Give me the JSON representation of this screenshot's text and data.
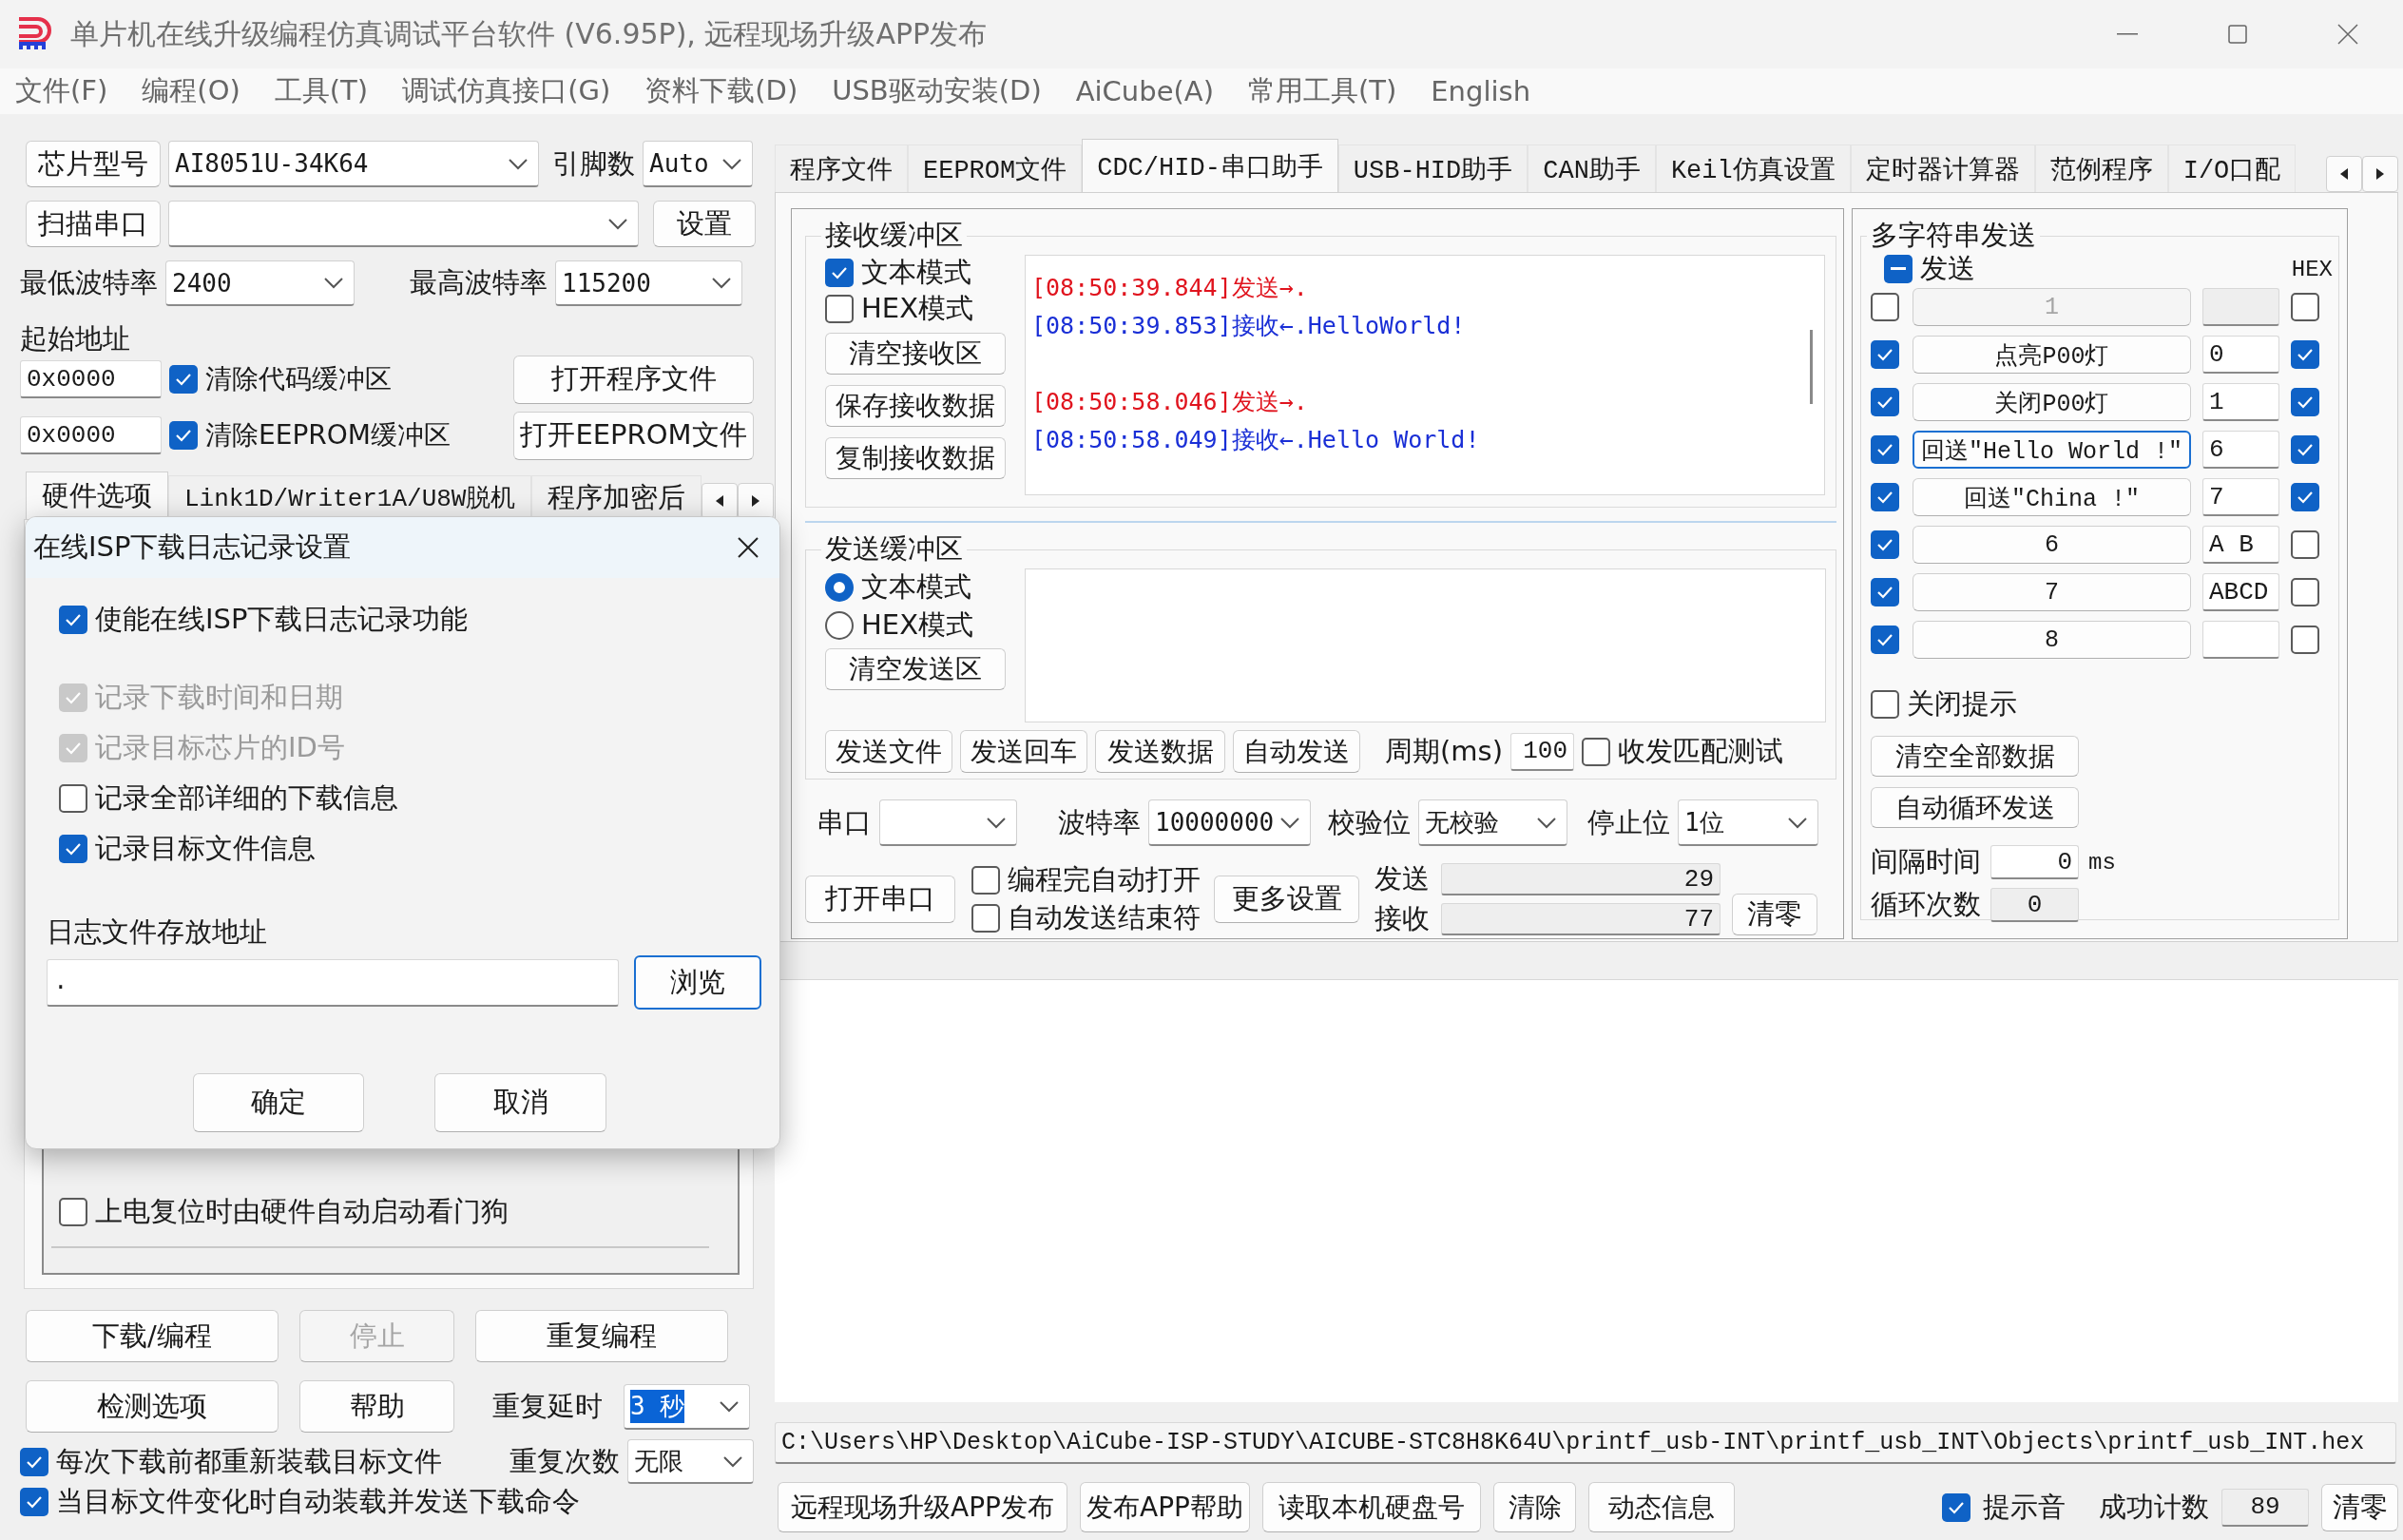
{
  "window": {
    "title": "单片机在线升级编程仿真调试平台软件 (V6.95P), 远程现场升级APP发布"
  },
  "menu": [
    "文件(F)",
    "编程(O)",
    "工具(T)",
    "调试仿真接口(G)",
    "资料下载(D)",
    "USB驱动安装(D)",
    "AiCube(A)",
    "常用工具(T)",
    "English"
  ],
  "left": {
    "chip_button": "芯片型号",
    "chip_model": "AI8051U-34K64",
    "pins_label": "引脚数",
    "pins": "Auto",
    "scan_button": "扫描串口",
    "settings_button": "设置",
    "min_baud_label": "最低波特率",
    "min_baud": "2400",
    "max_baud_label": "最高波特率",
    "max_baud": "115200",
    "start_address_label": "起始地址",
    "address_rows": [
      {
        "address": "0x0000",
        "label": "清除代码缓冲区",
        "checked": true,
        "button": "打开程序文件"
      },
      {
        "address": "0x0000",
        "label": "清除EEPROM缓冲区",
        "checked": true,
        "button": "打开EEPROM文件"
      }
    ],
    "tabs": [
      {
        "label": "硬件选项",
        "selected": true
      },
      {
        "label": "Link1D/Writer1A/U8W脱机",
        "selected": false
      },
      {
        "label": "程序加密后",
        "selected": false
      }
    ],
    "hardware_options": [
      {
        "label": "上电复位时由硬件自动启动看门狗",
        "checked": false
      }
    ],
    "buttons": [
      {
        "label": "下载/编程",
        "disabled": false
      },
      {
        "label": "停止",
        "disabled": true
      },
      {
        "label": "重复编程",
        "disabled": false
      },
      {
        "label": "检测选项",
        "disabled": false
      },
      {
        "label": "帮助",
        "disabled": false
      }
    ],
    "repeat_delay": {
      "label": "重复延时",
      "value": "3 秒",
      "highlighted": true
    },
    "repeat_count": {
      "label": "重复次数",
      "value": "无限",
      "highlighted": false
    },
    "options": [
      {
        "label": "每次下载前都重新装载目标文件",
        "checked": true
      },
      {
        "label": "当目标文件变化时自动装载并发送下载命令",
        "checked": true
      }
    ]
  },
  "dialog": {
    "title": "在线ISP下载日志记录设置",
    "enable": {
      "label": "使能在线ISP下载日志记录功能",
      "checked": true
    },
    "options": [
      {
        "label": "记录下载时间和日期",
        "checked": true,
        "disabled": true
      },
      {
        "label": "记录目标芯片的ID号",
        "checked": true,
        "disabled": true
      },
      {
        "label": "记录全部详细的下载信息",
        "checked": false,
        "disabled": false
      },
      {
        "label": "记录目标文件信息",
        "checked": true,
        "disabled": false
      }
    ],
    "path_label": "日志文件存放地址",
    "path": ".",
    "browse_button": "浏览",
    "ok_button": "确定",
    "cancel_button": "取消"
  },
  "tabs": [
    {
      "label": "程序文件",
      "selected": false
    },
    {
      "label": "EEPROM文件",
      "selected": false
    },
    {
      "label": "CDC/HID-串口助手",
      "selected": true
    },
    {
      "label": "USB-HID助手",
      "selected": false
    },
    {
      "label": "CAN助手",
      "selected": false
    },
    {
      "label": "Keil仿真设置",
      "selected": false
    },
    {
      "label": "定时器计算器",
      "selected": false
    },
    {
      "label": "范例程序",
      "selected": false
    },
    {
      "label": "I/O口配",
      "selected": false
    }
  ],
  "receive": {
    "title": "接收缓冲区",
    "modes": [
      {
        "label": "文本模式",
        "checked": true
      },
      {
        "label": "HEX模式",
        "checked": false
      }
    ],
    "buttons": [
      "清空接收区",
      "保存接收数据",
      "复制接收数据"
    ],
    "log": [
      {
        "lines": [
          {
            "kind": "sent",
            "text": "[08:50:39.844]发送→."
          },
          {
            "kind": "received",
            "text": "[08:50:39.853]接收←.HelloWorld!"
          }
        ]
      },
      {
        "lines": [
          {
            "kind": "sent",
            "text": "[08:50:58.046]发送→."
          },
          {
            "kind": "received",
            "text": "[08:50:58.049]接收←.Hello World!"
          }
        ]
      }
    ]
  },
  "send": {
    "title": "发送缓冲区",
    "modes": [
      {
        "label": "文本模式",
        "selected": true
      },
      {
        "label": "HEX模式",
        "selected": false
      }
    ],
    "clear_button": "清空发送区",
    "buttons": [
      "发送文件",
      "发送回车",
      "发送数据",
      "自动发送"
    ],
    "period_label": "周期(ms)",
    "period": "100",
    "match_test": {
      "label": "收发匹配测试",
      "checked": false
    }
  },
  "serial": {
    "port_label": "串口",
    "baud_label": "波特率",
    "baud": "10000000",
    "parity_label": "校验位",
    "parity": "无校验",
    "stop_label": "停止位",
    "stop": "1位",
    "open_button": "打开串口",
    "auto_options": [
      {
        "label": "编程完自动打开",
        "checked": false
      },
      {
        "label": "自动发送结束符",
        "checked": false
      }
    ],
    "more_button": "更多设置",
    "counters": [
      {
        "label": "发送",
        "value": "29"
      },
      {
        "label": "接收",
        "value": "77"
      }
    ],
    "clear_button": "清零"
  },
  "multi_send": {
    "title": "多字符串发送",
    "send_all": {
      "label": "发送",
      "indeterminate": true
    },
    "hex_label": "HEX",
    "rows": [
      {
        "enabled": false,
        "label": "1",
        "hex": false,
        "disabled": true,
        "focused": false
      },
      {
        "enabled": true,
        "label": "点亮P00灯",
        "data": "0",
        "hex": true,
        "disabled": false,
        "focused": false
      },
      {
        "enabled": true,
        "label": "关闭P00灯",
        "data": "1",
        "hex": true,
        "disabled": false,
        "focused": false
      },
      {
        "enabled": true,
        "label": "回送\"Hello World !\"",
        "data": "6",
        "hex": true,
        "disabled": false,
        "focused": true
      },
      {
        "enabled": true,
        "label": "回送\"China !\"",
        "data": "7",
        "hex": true,
        "disabled": false,
        "focused": false
      },
      {
        "enabled": true,
        "label": "6",
        "data": "A B",
        "hex": false,
        "disabled": false,
        "focused": false
      },
      {
        "enabled": true,
        "label": "7",
        "data": "ABCD",
        "hex": false,
        "disabled": false,
        "focused": false
      },
      {
        "enabled": true,
        "label": "8",
        "hex": false,
        "disabled": false,
        "focused": false
      }
    ],
    "close_hint": {
      "label": "关闭提示",
      "checked": false
    },
    "clear_button": "清空全部数据",
    "loop_button": "自动循环发送",
    "interval_label": "间隔时间",
    "interval": "0",
    "interval_unit": "ms",
    "loop_count_label": "循环次数",
    "loop_count": "0"
  },
  "file_path": "C:\\Users\\HP\\Desktop\\AiCube-ISP-STUDY\\AICUBE-STC8H8K64U\\printf_usb-INT\\printf_usb_INT\\Objects\\printf_usb_INT.hex",
  "bottom": {
    "buttons": [
      "远程现场升级APP发布",
      "发布APP帮助",
      "读取本机硬盘号",
      "清除",
      "动态信息"
    ],
    "sound": {
      "label": "提示音",
      "checked": true
    },
    "success_label": "成功计数",
    "success_count": "89",
    "reset_button": "清零"
  }
}
